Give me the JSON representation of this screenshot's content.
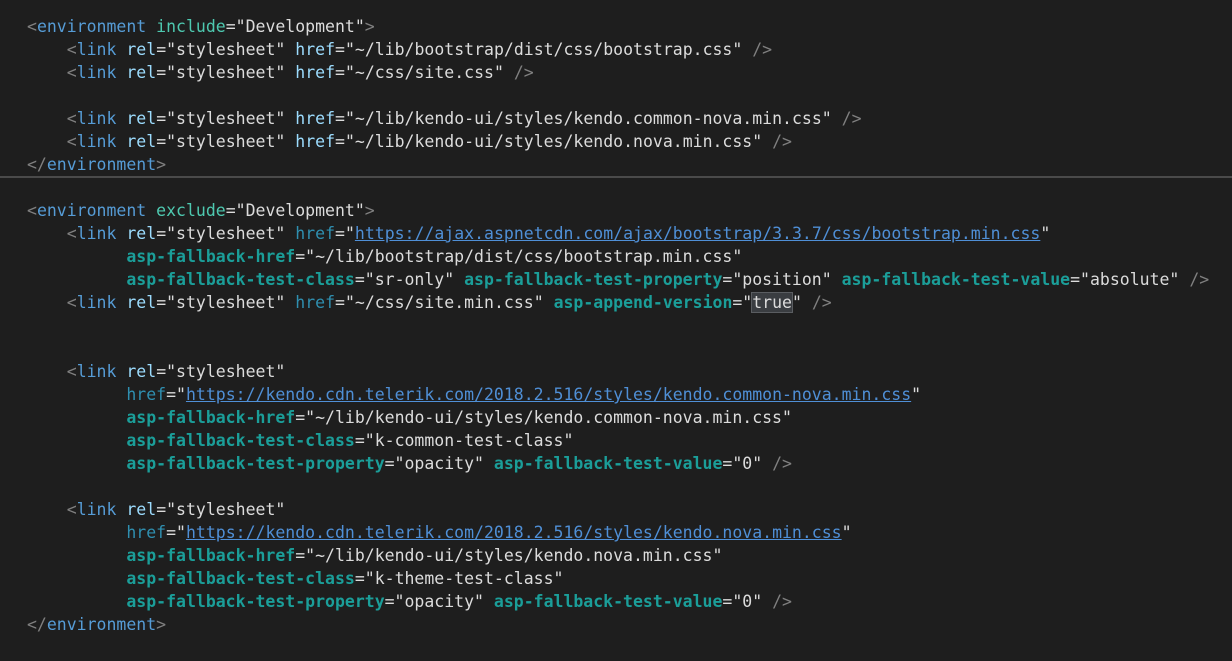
{
  "editor": {
    "lines": [
      [
        [
          "p",
          "<"
        ],
        [
          "tag",
          "environment"
        ],
        [
          "txt",
          " "
        ],
        [
          "attr",
          "include"
        ],
        [
          "txt",
          "=\"Development\""
        ],
        [
          "p",
          ">"
        ]
      ],
      [
        [
          "txt",
          "    "
        ],
        [
          "p",
          "<"
        ],
        [
          "tag",
          "link"
        ],
        [
          "txt",
          " "
        ],
        [
          "attr2",
          "rel"
        ],
        [
          "txt",
          "=\"stylesheet\" "
        ],
        [
          "attr2",
          "href"
        ],
        [
          "txt",
          "=\"~/lib/bootstrap/dist/css/bootstrap.css\" "
        ],
        [
          "p",
          "/>"
        ]
      ],
      [
        [
          "txt",
          "    "
        ],
        [
          "p",
          "<"
        ],
        [
          "tag",
          "link"
        ],
        [
          "txt",
          " "
        ],
        [
          "attr2",
          "rel"
        ],
        [
          "txt",
          "=\"stylesheet\" "
        ],
        [
          "attr2",
          "href"
        ],
        [
          "txt",
          "=\"~/css/site.css\" "
        ],
        [
          "p",
          "/>"
        ]
      ],
      [],
      [
        [
          "txt",
          "    "
        ],
        [
          "p",
          "<"
        ],
        [
          "tag",
          "link"
        ],
        [
          "txt",
          " "
        ],
        [
          "attr2",
          "rel"
        ],
        [
          "txt",
          "=\"stylesheet\" "
        ],
        [
          "attr2",
          "href"
        ],
        [
          "txt",
          "=\"~/lib/kendo-ui/styles/kendo.common-nova.min.css\" "
        ],
        [
          "p",
          "/>"
        ]
      ],
      [
        [
          "txt",
          "    "
        ],
        [
          "p",
          "<"
        ],
        [
          "tag",
          "link"
        ],
        [
          "txt",
          " "
        ],
        [
          "attr2",
          "rel"
        ],
        [
          "txt",
          "=\"stylesheet\" "
        ],
        [
          "attr2",
          "href"
        ],
        [
          "txt",
          "=\"~/lib/kendo-ui/styles/kendo.nova.min.css\" "
        ],
        [
          "p",
          "/>"
        ]
      ],
      [
        [
          "p",
          "</"
        ],
        [
          "tag",
          "environment"
        ],
        [
          "p",
          ">"
        ]
      ],
      [],
      [
        [
          "p",
          "<"
        ],
        [
          "tag",
          "environment"
        ],
        [
          "txt",
          " "
        ],
        [
          "attr",
          "exclude"
        ],
        [
          "txt",
          "=\"Development\""
        ],
        [
          "p",
          ">"
        ]
      ],
      [
        [
          "txt",
          "    "
        ],
        [
          "p",
          "<"
        ],
        [
          "tag",
          "link"
        ],
        [
          "txt",
          " "
        ],
        [
          "attr2",
          "rel"
        ],
        [
          "txt",
          "=\"stylesheet\" "
        ],
        [
          "aspname",
          "href"
        ],
        [
          "txt",
          "=\""
        ],
        [
          "link",
          "https://ajax.aspnetcdn.com/ajax/bootstrap/3.3.7/css/bootstrap.min.css"
        ],
        [
          "txt",
          "\""
        ]
      ],
      [
        [
          "txt",
          "          "
        ],
        [
          "aspattr",
          "asp-fallback-href"
        ],
        [
          "txt",
          "=\"~/lib/bootstrap/dist/css/bootstrap.min.css\""
        ]
      ],
      [
        [
          "txt",
          "          "
        ],
        [
          "aspattr",
          "asp-fallback-test-class"
        ],
        [
          "txt",
          "=\"sr-only\" "
        ],
        [
          "aspattr",
          "asp-fallback-test-property"
        ],
        [
          "txt",
          "=\"position\" "
        ],
        [
          "aspattr",
          "asp-fallback-test-value"
        ],
        [
          "txt",
          "=\"absolute\" "
        ],
        [
          "p",
          "/>"
        ]
      ],
      [
        [
          "txt",
          "    "
        ],
        [
          "p",
          "<"
        ],
        [
          "tag",
          "link"
        ],
        [
          "txt",
          " "
        ],
        [
          "attr2",
          "rel"
        ],
        [
          "txt",
          "=\"stylesheet\" "
        ],
        [
          "aspname",
          "href"
        ],
        [
          "txt",
          "=\"~/css/site.min.css\" "
        ],
        [
          "aspattr",
          "asp-append-version"
        ],
        [
          "txt",
          "=\""
        ],
        [
          "hl",
          "true"
        ],
        [
          "txt",
          "\" "
        ],
        [
          "p",
          "/>"
        ]
      ],
      [],
      [],
      [
        [
          "txt",
          "    "
        ],
        [
          "p",
          "<"
        ],
        [
          "tag",
          "link"
        ],
        [
          "txt",
          " "
        ],
        [
          "attr2",
          "rel"
        ],
        [
          "txt",
          "=\"stylesheet\""
        ]
      ],
      [
        [
          "txt",
          "          "
        ],
        [
          "aspname",
          "href"
        ],
        [
          "txt",
          "=\""
        ],
        [
          "link",
          "https://kendo.cdn.telerik.com/2018.2.516/styles/kendo.common-nova.min.css"
        ],
        [
          "txt",
          "\""
        ]
      ],
      [
        [
          "txt",
          "          "
        ],
        [
          "aspattr",
          "asp-fallback-href"
        ],
        [
          "txt",
          "=\"~/lib/kendo-ui/styles/kendo.common-nova.min.css\""
        ]
      ],
      [
        [
          "txt",
          "          "
        ],
        [
          "aspattr",
          "asp-fallback-test-class"
        ],
        [
          "txt",
          "=\"k-common-test-class\""
        ]
      ],
      [
        [
          "txt",
          "          "
        ],
        [
          "aspattr",
          "asp-fallback-test-property"
        ],
        [
          "txt",
          "=\"opacity\" "
        ],
        [
          "aspattr",
          "asp-fallback-test-value"
        ],
        [
          "txt",
          "=\"0\" "
        ],
        [
          "p",
          "/>"
        ]
      ],
      [],
      [
        [
          "txt",
          "    "
        ],
        [
          "p",
          "<"
        ],
        [
          "tag",
          "link"
        ],
        [
          "txt",
          " "
        ],
        [
          "attr2",
          "rel"
        ],
        [
          "txt",
          "=\"stylesheet\""
        ]
      ],
      [
        [
          "txt",
          "          "
        ],
        [
          "aspname",
          "href"
        ],
        [
          "txt",
          "=\""
        ],
        [
          "link",
          "https://kendo.cdn.telerik.com/2018.2.516/styles/kendo.nova.min.css"
        ],
        [
          "txt",
          "\""
        ]
      ],
      [
        [
          "txt",
          "          "
        ],
        [
          "aspattr",
          "asp-fallback-href"
        ],
        [
          "txt",
          "=\"~/lib/kendo-ui/styles/kendo.nova.min.css\""
        ]
      ],
      [
        [
          "txt",
          "          "
        ],
        [
          "aspattr",
          "asp-fallback-test-class"
        ],
        [
          "txt",
          "=\"k-theme-test-class\""
        ]
      ],
      [
        [
          "txt",
          "          "
        ],
        [
          "aspattr",
          "asp-fallback-test-property"
        ],
        [
          "txt",
          "=\"opacity\" "
        ],
        [
          "aspattr",
          "asp-fallback-test-value"
        ],
        [
          "txt",
          "=\"0\" "
        ],
        [
          "p",
          "/>"
        ]
      ],
      [
        [
          "p",
          "</"
        ],
        [
          "tag",
          "environment"
        ],
        [
          "p",
          ">"
        ]
      ]
    ]
  }
}
